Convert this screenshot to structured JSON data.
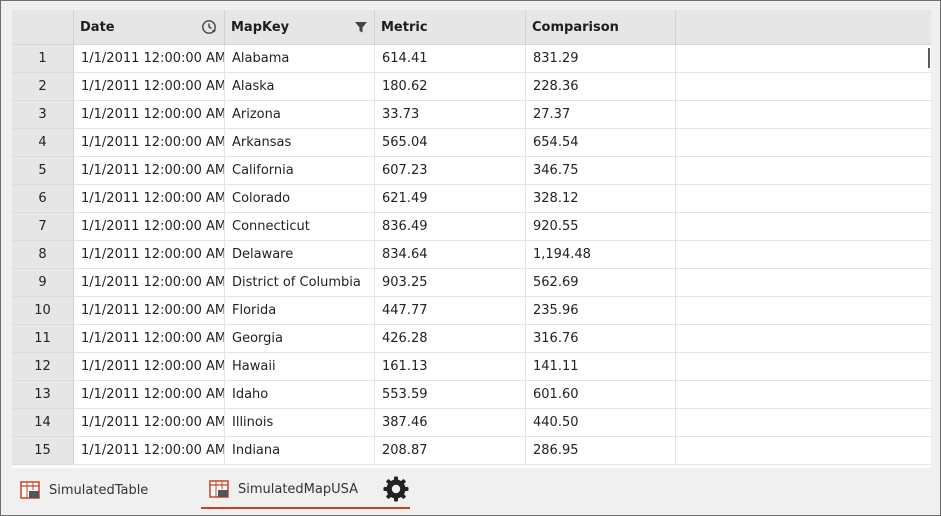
{
  "table": {
    "columns": [
      {
        "label": "",
        "icon": null
      },
      {
        "label": "Date",
        "icon": "clock-filter-icon"
      },
      {
        "label": "MapKey",
        "icon": "filter-icon"
      },
      {
        "label": "Metric",
        "icon": null
      },
      {
        "label": "Comparison",
        "icon": null
      }
    ],
    "rows": [
      {
        "n": "1",
        "date": "1/1/2011 12:00:00 AM",
        "key": "Alabama",
        "metric": "614.41",
        "comparison": "831.29"
      },
      {
        "n": "2",
        "date": "1/1/2011 12:00:00 AM",
        "key": "Alaska",
        "metric": "180.62",
        "comparison": "228.36"
      },
      {
        "n": "3",
        "date": "1/1/2011 12:00:00 AM",
        "key": "Arizona",
        "metric": "33.73",
        "comparison": "27.37"
      },
      {
        "n": "4",
        "date": "1/1/2011 12:00:00 AM",
        "key": "Arkansas",
        "metric": "565.04",
        "comparison": "654.54"
      },
      {
        "n": "5",
        "date": "1/1/2011 12:00:00 AM",
        "key": "California",
        "metric": "607.23",
        "comparison": "346.75"
      },
      {
        "n": "6",
        "date": "1/1/2011 12:00:00 AM",
        "key": "Colorado",
        "metric": "621.49",
        "comparison": "328.12"
      },
      {
        "n": "7",
        "date": "1/1/2011 12:00:00 AM",
        "key": "Connecticut",
        "metric": "836.49",
        "comparison": "920.55"
      },
      {
        "n": "8",
        "date": "1/1/2011 12:00:00 AM",
        "key": "Delaware",
        "metric": "834.64",
        "comparison": "1,194.48"
      },
      {
        "n": "9",
        "date": "1/1/2011 12:00:00 AM",
        "key": "District of Columbia",
        "metric": "903.25",
        "comparison": "562.69"
      },
      {
        "n": "10",
        "date": "1/1/2011 12:00:00 AM",
        "key": "Florida",
        "metric": "447.77",
        "comparison": "235.96"
      },
      {
        "n": "11",
        "date": "1/1/2011 12:00:00 AM",
        "key": "Georgia",
        "metric": "426.28",
        "comparison": "316.76"
      },
      {
        "n": "12",
        "date": "1/1/2011 12:00:00 AM",
        "key": "Hawaii",
        "metric": "161.13",
        "comparison": "141.11"
      },
      {
        "n": "13",
        "date": "1/1/2011 12:00:00 AM",
        "key": "Idaho",
        "metric": "553.59",
        "comparison": "601.60"
      },
      {
        "n": "14",
        "date": "1/1/2011 12:00:00 AM",
        "key": "Illinois",
        "metric": "387.46",
        "comparison": "440.50"
      },
      {
        "n": "15",
        "date": "1/1/2011 12:00:00 AM",
        "key": "Indiana",
        "metric": "208.87",
        "comparison": "286.95"
      }
    ]
  },
  "tabs": [
    {
      "label": "SimulatedTable",
      "icon": "sim-table-icon",
      "active": false
    },
    {
      "label": "SimulatedMapUSA",
      "icon": "sim-table-icon",
      "active": true
    }
  ],
  "colors": {
    "accent": "#c9431d",
    "header_bg": "#e6e6e6"
  }
}
